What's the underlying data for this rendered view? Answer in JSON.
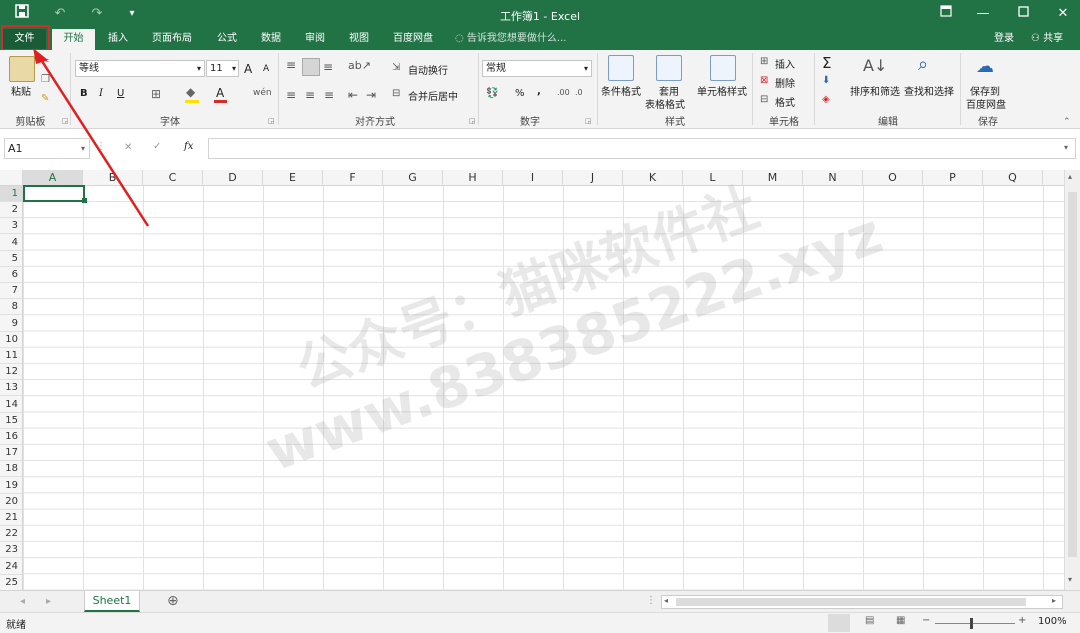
{
  "window": {
    "title": "工作簿1 - Excel"
  },
  "qat": {
    "save_icon": "save-icon",
    "undo_icon": "undo-icon",
    "redo_icon": "redo-icon",
    "customize": "▾"
  },
  "tabs": [
    "文件",
    "开始",
    "插入",
    "页面布局",
    "公式",
    "数据",
    "审阅",
    "视图",
    "百度网盘"
  ],
  "active_tab": "开始",
  "tellme": "告诉我您想要做什么...",
  "signin": "登录",
  "share": "共享",
  "ribbon": {
    "clipboard": {
      "paste": "粘贴",
      "label": "剪贴板"
    },
    "font": {
      "name": "等线",
      "size": "11",
      "bold": "B",
      "italic": "I",
      "underline": "U",
      "grow": "A",
      "shrink": "A",
      "label": "字体",
      "fill_color": "#ffe000",
      "font_color": "#d62b2b"
    },
    "align": {
      "wrap": "自动换行",
      "merge": "合并后居中",
      "label": "对齐方式"
    },
    "number": {
      "format": "常规",
      "percent": "%",
      "comma": ",",
      "label": "数字"
    },
    "styles": {
      "cond": "条件格式",
      "table1": "套用",
      "table2": "表格格式",
      "cell": "单元格样式",
      "label": "样式"
    },
    "cells": {
      "insert": "插入",
      "delete": "删除",
      "format": "格式",
      "label": "单元格"
    },
    "edit": {
      "sort": "排序和筛选",
      "find": "查找和选择",
      "label": "编辑"
    },
    "save": {
      "line1": "保存到",
      "line2": "百度网盘",
      "label": "保存"
    }
  },
  "formula": {
    "namebox": "A1",
    "fx": "fx",
    "cancel": "✕",
    "enter": "✓",
    "value": ""
  },
  "columns": [
    "A",
    "B",
    "C",
    "D",
    "E",
    "F",
    "G",
    "H",
    "I",
    "J",
    "K",
    "L",
    "M",
    "N",
    "O",
    "P",
    "Q"
  ],
  "rows": [
    "1",
    "2",
    "3",
    "4",
    "5",
    "6",
    "7",
    "8",
    "9",
    "10",
    "11",
    "12",
    "13",
    "14",
    "15",
    "16",
    "17",
    "18",
    "19",
    "20",
    "21",
    "22",
    "23",
    "24",
    "25"
  ],
  "sheet": {
    "name": "Sheet1",
    "add": "⊕"
  },
  "status": {
    "ready": "就绪",
    "zoom": "100%",
    "minus": "−",
    "plus": "+"
  },
  "watermark": {
    "line1": "公众号：猫咪软件社",
    "line2": "www.838385222.xyz"
  },
  "colors": {
    "accent": "#217346",
    "highlight": "#d62b2b"
  }
}
